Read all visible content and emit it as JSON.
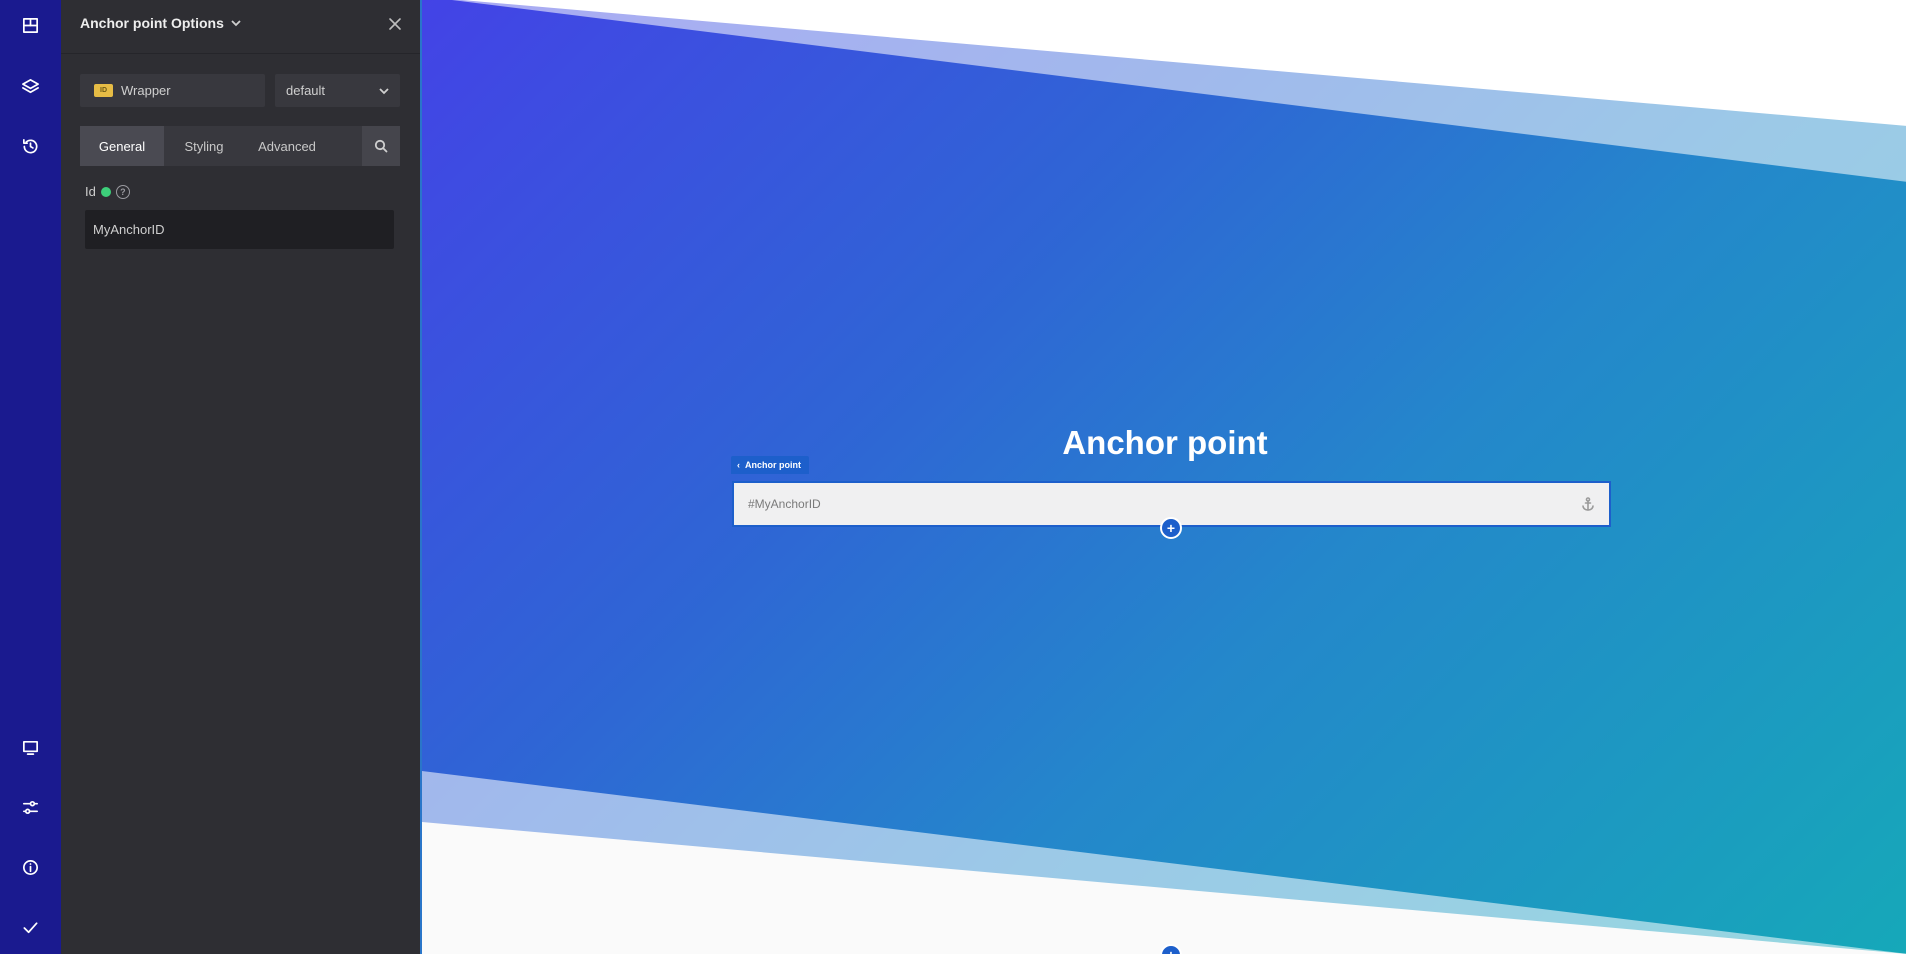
{
  "rail": {
    "top_items": [
      "elements-icon",
      "layers-icon",
      "history-icon"
    ],
    "bottom_items": [
      "desktop-icon",
      "settings-sliders-icon",
      "info-icon",
      "check-icon"
    ],
    "background": "#1a1a8f"
  },
  "panel": {
    "title": "Anchor point Options",
    "element_badge": "ID",
    "element_name": "Wrapper",
    "preset": "default",
    "tabs": [
      {
        "label": "General",
        "active": true
      },
      {
        "label": "Styling",
        "active": false
      },
      {
        "label": "Advanced",
        "active": false
      }
    ],
    "id_field": {
      "label": "Id",
      "help": "?",
      "value": "MyAnchorID"
    }
  },
  "canvas": {
    "heading": "Anchor point",
    "anchor_tag": "Anchor point",
    "anchor_value": "#MyAnchorID",
    "add_label": "+",
    "gradient": [
      "#4343e6",
      "#16a8b9"
    ],
    "accent": "#1d5fcb"
  }
}
